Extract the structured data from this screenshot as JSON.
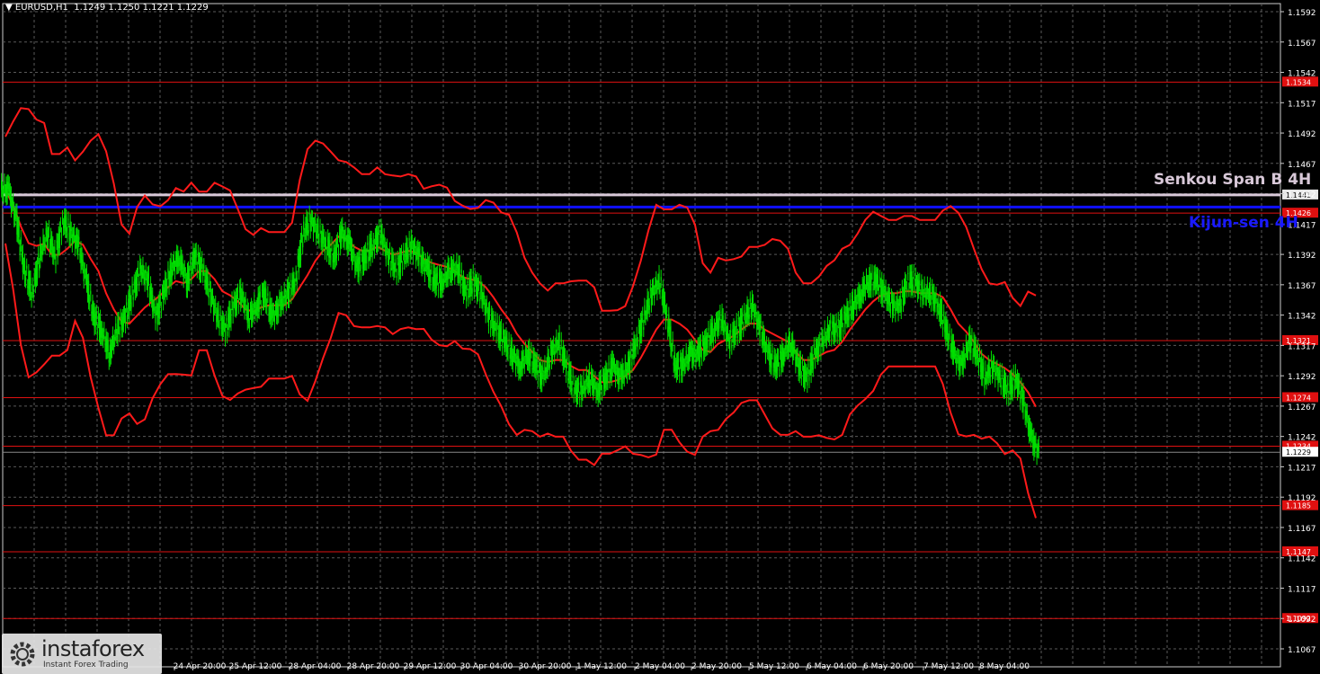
{
  "header": {
    "symbol": "EURUSD,H1",
    "ohlc": "1.1249 1.1250 1.1221 1.1229"
  },
  "colors": {
    "background": "#000000",
    "grid": "#5a5a5a",
    "candles": "#00e000",
    "bollinger": "#ff1a1a",
    "levels": "#e01010",
    "kijun": "#1010ff",
    "senkou": "#d8c8d8",
    "axis_text": "#ffffff"
  },
  "indicators": {
    "senkou_label": "Senkou Span B 4H",
    "kijun_label": "Kijun-sen 4H"
  },
  "logo": {
    "brand": "instaforex",
    "tagline": "Instant Forex Trading",
    "icon": "gear-logo-icon"
  },
  "chart_data": {
    "type": "candlestick",
    "symbol": "EURUSD",
    "timeframe": "H1",
    "ylim": [
      1.1055,
      1.16
    ],
    "y_ticks": [
      "1.1592",
      "1.1567",
      "1.1542",
      "1.1517",
      "1.1492",
      "1.1467",
      "1.1442",
      "1.1417",
      "1.1392",
      "1.1367",
      "1.1342",
      "1.1317",
      "1.1292",
      "1.1267",
      "1.1242",
      "1.1217",
      "1.1192",
      "1.1167",
      "1.1142",
      "1.1117",
      "1.1092",
      "1.1067"
    ],
    "x_ticks": [
      "24 Apr 20:00",
      "25 Apr 12:00",
      "28 Apr 04:00",
      "28 Apr 20:00",
      "29 Apr 12:00",
      "30 Apr 04:00",
      "30 Apr 20:00",
      "1 May 12:00",
      "2 May 04:00",
      "2 May 20:00",
      "5 May 12:00",
      "6 May 04:00",
      "6 May 20:00",
      "7 May 12:00",
      "8 May 04:00"
    ],
    "levels": [
      {
        "value": 1.1534,
        "label": "1.1534"
      },
      {
        "value": 1.1426,
        "label": "1.1426"
      },
      {
        "value": 1.1321,
        "label": "1.1321"
      },
      {
        "value": 1.1274,
        "label": "1.1274"
      },
      {
        "value": 1.1234,
        "label": "1.1234"
      },
      {
        "value": 1.1185,
        "label": "1.1185"
      },
      {
        "value": 1.1147,
        "label": "1.1147"
      },
      {
        "value": 1.1092,
        "label": "1.1092"
      }
    ],
    "senkou_span_b": {
      "value": 1.1441,
      "label": "1.1441"
    },
    "kijun_sen": {
      "value": 1.1431
    },
    "current_price": {
      "value": 1.1229,
      "label": "1.1229"
    },
    "closes": [
      1.1445,
      1.142,
      1.138,
      1.136,
      1.139,
      1.141,
      1.139,
      1.142,
      1.141,
      1.14,
      1.137,
      1.134,
      1.133,
      1.131,
      1.133,
      1.134,
      1.136,
      1.138,
      1.137,
      1.134,
      1.136,
      1.138,
      1.139,
      1.137,
      1.139,
      1.138,
      1.136,
      1.134,
      1.133,
      1.135,
      1.136,
      1.134,
      1.135,
      1.136,
      1.134,
      1.135,
      1.136,
      1.137,
      1.141,
      1.142,
      1.141,
      1.14,
      1.139,
      1.141,
      1.14,
      1.138,
      1.139,
      1.14,
      1.141,
      1.139,
      1.138,
      1.139,
      1.14,
      1.139,
      1.138,
      1.137,
      1.137,
      1.138,
      1.138,
      1.136,
      1.137,
      1.136,
      1.134,
      1.133,
      1.132,
      1.131,
      1.13,
      1.131,
      1.13,
      1.129,
      1.131,
      1.132,
      1.13,
      1.128,
      1.128,
      1.129,
      1.128,
      1.129,
      1.13,
      1.129,
      1.13,
      1.132,
      1.134,
      1.136,
      1.137,
      1.134,
      1.13,
      1.13,
      1.131,
      1.131,
      1.132,
      1.133,
      1.134,
      1.132,
      1.133,
      1.134,
      1.135,
      1.133,
      1.131,
      1.13,
      1.131,
      1.132,
      1.13,
      1.129,
      1.131,
      1.132,
      1.133,
      1.133,
      1.134,
      1.135,
      1.136,
      1.137,
      1.137,
      1.136,
      1.135,
      1.135,
      1.137,
      1.137,
      1.136,
      1.136,
      1.135,
      1.133,
      1.131,
      1.13,
      1.132,
      1.131,
      1.129,
      1.13,
      1.129,
      1.128,
      1.129,
      1.127,
      1.124,
      1.1229
    ]
  }
}
